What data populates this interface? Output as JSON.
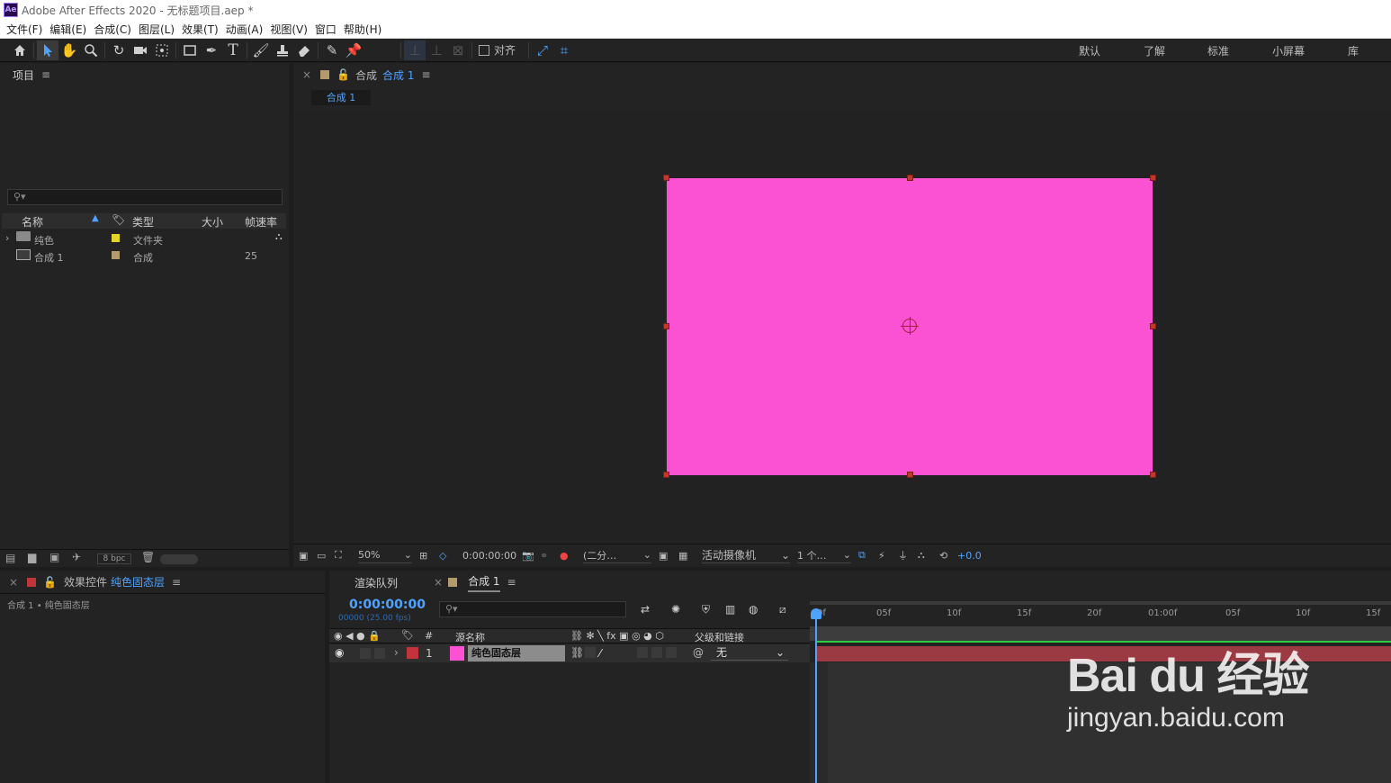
{
  "window": {
    "title": "Adobe After Effects 2020 - 无标题项目.aep *",
    "logo": "Ae"
  },
  "menu": [
    "文件(F)",
    "编辑(E)",
    "合成(C)",
    "图层(L)",
    "效果(T)",
    "动画(A)",
    "视图(V)",
    "窗口",
    "帮助(H)"
  ],
  "toolbar": {
    "align_label": "对齐"
  },
  "workspaces": [
    "默认",
    "了解",
    "标准",
    "小屏幕",
    "库"
  ],
  "project": {
    "title": "项目",
    "search_placeholder": "",
    "columns": {
      "name": "名称",
      "type": "类型",
      "size": "大小",
      "fps": "帧速率"
    },
    "items": [
      {
        "name": "纯色",
        "type": "文件夹",
        "fps": "",
        "color": "#e3d32c"
      },
      {
        "name": "合成 1",
        "type": "合成",
        "fps": "25",
        "color": "#b39b6e"
      }
    ],
    "bpc": "8 bpc"
  },
  "comp_panel": {
    "label": "合成",
    "name": "合成 1",
    "tab": "合成 1",
    "zoom": "50%",
    "timecode": "0:00:00:00",
    "resolution": "(二分…",
    "camera": "活动摄像机",
    "views": "1 个…",
    "exposure": "+0.0",
    "solid_color": "#fa52d2"
  },
  "effects_panel": {
    "label": "效果控件",
    "layer": "纯色固态层",
    "breadcrumb": "合成 1 • 纯色固态层"
  },
  "timeline": {
    "tabs": [
      "渲染队列",
      "合成 1"
    ],
    "timecode": "0:00:00:00",
    "frame_info": "00000 (25.00 fps)",
    "columns": {
      "num": "#",
      "source": "源名称",
      "parent": "父级和链接"
    },
    "layer": {
      "index": "1",
      "name": "纯色固态层",
      "parent": "无",
      "color": "#c3333b"
    },
    "ruler": [
      "0f",
      "05f",
      "10f",
      "15f",
      "20f",
      "01:00f",
      "05f",
      "10f",
      "15f"
    ]
  },
  "watermark": {
    "text": "jingyan.baidu.com",
    "logo": "Bai du 经验"
  }
}
